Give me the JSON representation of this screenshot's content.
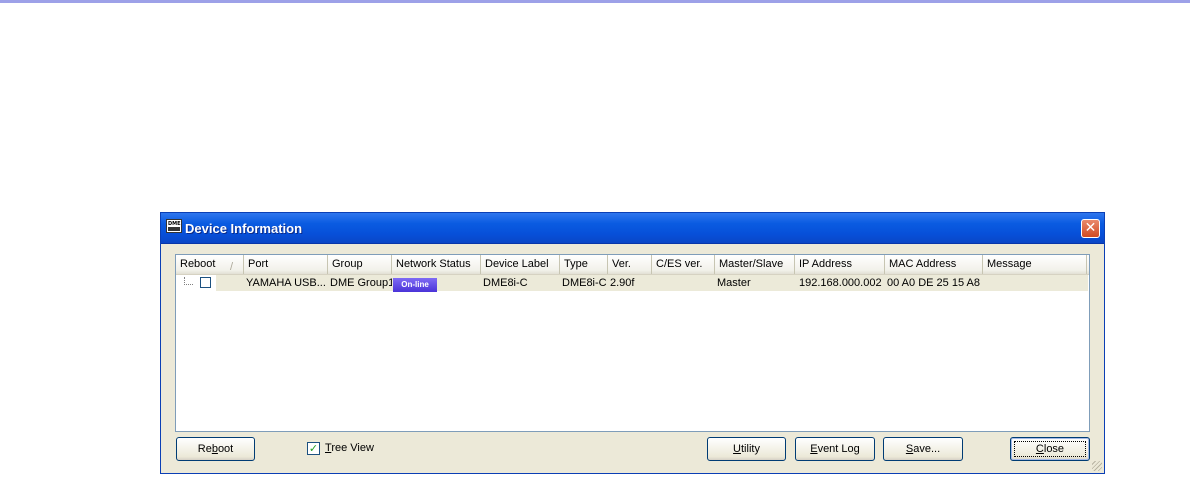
{
  "window": {
    "title": "Device Information",
    "close_glyph": "✕",
    "app_icon": "dme-icon",
    "app_icon_text": "DME"
  },
  "columns": [
    "Reboot",
    "Port",
    "Group",
    "Network Status",
    "Device Label",
    "Type",
    "Ver.",
    "C/ES ver.",
    "Master/Slave",
    "IP Address",
    "MAC Address",
    "Message"
  ],
  "sort_glyph": "/",
  "rows": [
    {
      "reboot_checked": false,
      "port": "YAMAHA USB...",
      "group": "DME Group1",
      "network_status": "On-line",
      "device_label": "DME8i-C",
      "type": "DME8i-C",
      "ver": "2.90f",
      "ces_ver": "",
      "master_slave": "Master",
      "ip_address": "192.168.000.002",
      "mac_address": "00 A0 DE 25 15 A8",
      "message": ""
    }
  ],
  "buttons": {
    "reboot": {
      "pre": "Re",
      "ul": "b",
      "post": "oot"
    },
    "utility": {
      "pre": "",
      "ul": "U",
      "post": "tility"
    },
    "event_log": {
      "pre": "",
      "ul": "E",
      "post": "vent Log"
    },
    "save": {
      "pre": "",
      "ul": "S",
      "post": "ave..."
    },
    "close": {
      "pre": "",
      "ul": "C",
      "post": "lose"
    }
  },
  "tree_view": {
    "checked": true,
    "check_glyph": "✓",
    "ul": "T",
    "post": "ree View"
  },
  "colors": {
    "titlebar": "#0a5be1",
    "status_badge": "#5a43e0",
    "row_highlight": "#ecead9"
  }
}
